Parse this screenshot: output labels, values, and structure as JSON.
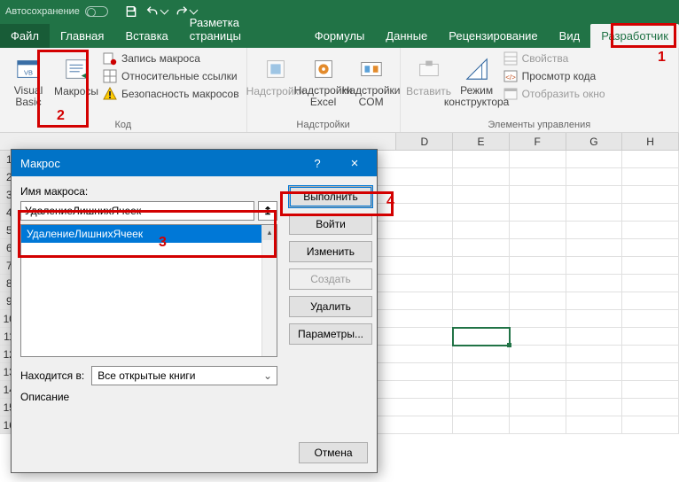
{
  "titlebar": {
    "autosave": "Автосохранение"
  },
  "tabs": {
    "file": "Файл",
    "home": "Главная",
    "insert": "Вставка",
    "pagelayout": "Разметка страницы",
    "formulas": "Формулы",
    "data": "Данные",
    "review": "Рецензирование",
    "view": "Вид",
    "developer": "Разработчик"
  },
  "ribbon": {
    "code": {
      "vb": "Visual Basic",
      "macros": "Макросы",
      "record": "Запись макроса",
      "relative": "Относительные ссылки",
      "security": "Безопасность макросов",
      "group": "Код"
    },
    "addins": {
      "addins": "Надстройки",
      "excel": "Надстройки Excel",
      "com": "Надстройки COM",
      "group": "Надстройки"
    },
    "controls": {
      "insert": "Вставить",
      "design": "Режим конструктора",
      "properties": "Свойства",
      "viewcode": "Просмотр кода",
      "showdlg": "Отобразить окно",
      "group": "Элементы управления"
    }
  },
  "columns": [
    "D",
    "E",
    "F",
    "G",
    "H"
  ],
  "rows": [
    "1",
    "2",
    "3",
    "4",
    "5",
    "6",
    "7",
    "8",
    "9",
    "10",
    "11",
    "12",
    "13",
    "14",
    "15",
    "16"
  ],
  "selected_cell": {
    "col": "E",
    "row": "11"
  },
  "dialog": {
    "title": "Макрос",
    "name_label": "Имя макроса:",
    "name_value": "УдалениеЛишнихЯчеек",
    "list": [
      "УдалениеЛишнихЯчеек"
    ],
    "location_label": "Находится в:",
    "location_value": "Все открытые книги",
    "description_label": "Описание",
    "buttons": {
      "run": "Выполнить",
      "stepinto": "Войти",
      "edit": "Изменить",
      "create": "Создать",
      "delete": "Удалить",
      "options": "Параметры...",
      "cancel": "Отмена"
    }
  },
  "annotations": {
    "1": "1",
    "2": "2",
    "3": "3",
    "4": "4"
  }
}
